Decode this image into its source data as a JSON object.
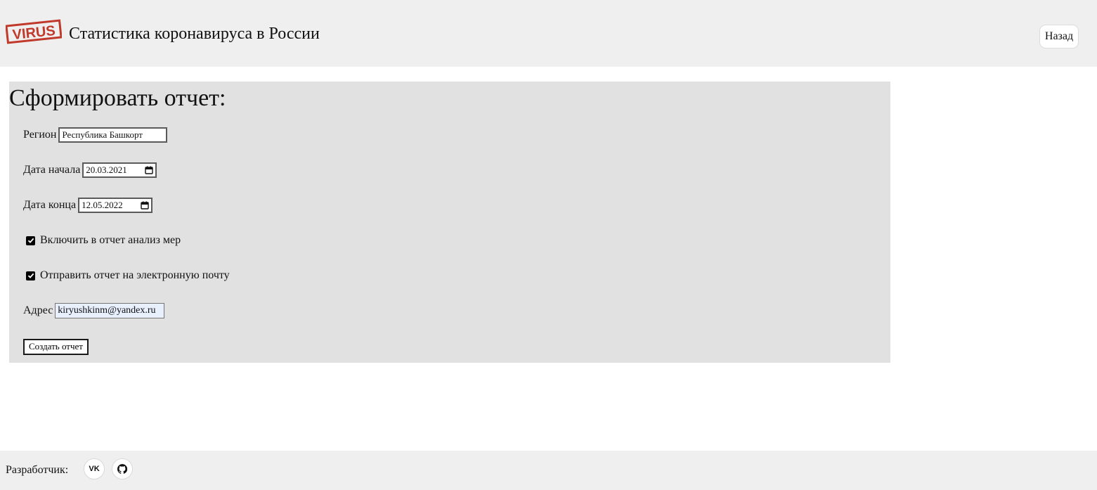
{
  "header": {
    "logo_text": "VIRUS",
    "title": "Статистика коронавируса в России",
    "back_label": "Назад"
  },
  "report": {
    "title": "Сформировать отчет:",
    "region": {
      "label": "Регион",
      "value": "Республика Башкорт"
    },
    "start_date": {
      "label": "Дата начала",
      "value": "20.03.2021"
    },
    "end_date": {
      "label": "Дата конца",
      "value": "12.05.2022"
    },
    "include_measures": {
      "label": "Включить в отчет анализ мер",
      "checked": true
    },
    "send_email": {
      "label": "Отправить отчет на электронную почту",
      "checked": true
    },
    "address": {
      "label": "Адрес",
      "value": "kiryushkinm@yandex.ru"
    },
    "submit_label": "Создать отчет"
  },
  "footer": {
    "developer_label": "Разработчик:",
    "vk_icon": "vk-icon",
    "github_icon": "github-icon"
  },
  "colors": {
    "header_bg": "#efefef",
    "panel_bg": "#e1e1e1",
    "logo_red": "#c0392b",
    "autofill_bg": "#e8f0fe"
  }
}
